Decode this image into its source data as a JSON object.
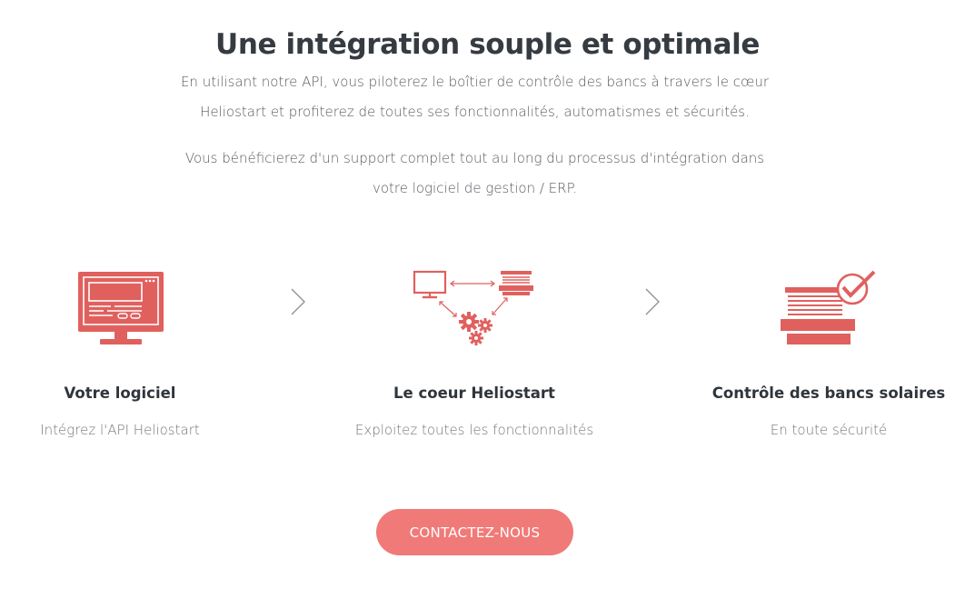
{
  "hero": {
    "title": "Une intégration souple et optimale",
    "paragraph_1_line_1": "En utilisant notre API, vous piloterez le boîtier de contrôle des bancs à travers le cœur",
    "paragraph_1_line_2": "Heliostart et profiterez de toutes ses fonctionnalités, automatismes et sécurités.",
    "paragraph_2_line_1": "Vous bénéficierez d'un support complet tout au long du processus d'intégration dans",
    "paragraph_2_line_2": "votre logiciel de gestion / ERP."
  },
  "steps": [
    {
      "icon": "monitor-software-icon",
      "title": "Votre logiciel",
      "subtitle": "Intégrez l'API Heliostart"
    },
    {
      "icon": "network-gears-icon",
      "title": "Le coeur Heliostart",
      "subtitle": "Exploitez toutes les fonctionnalités"
    },
    {
      "icon": "sunbed-check-icon",
      "title": "Contrôle des bancs solaires",
      "subtitle": "En toute sécurité"
    }
  ],
  "cta": {
    "label": "CONTACTEZ-NOUS"
  },
  "colors": {
    "accent": "#e0605e",
    "button": "#f07a78",
    "heading": "#353b41",
    "text": "#555b61"
  }
}
